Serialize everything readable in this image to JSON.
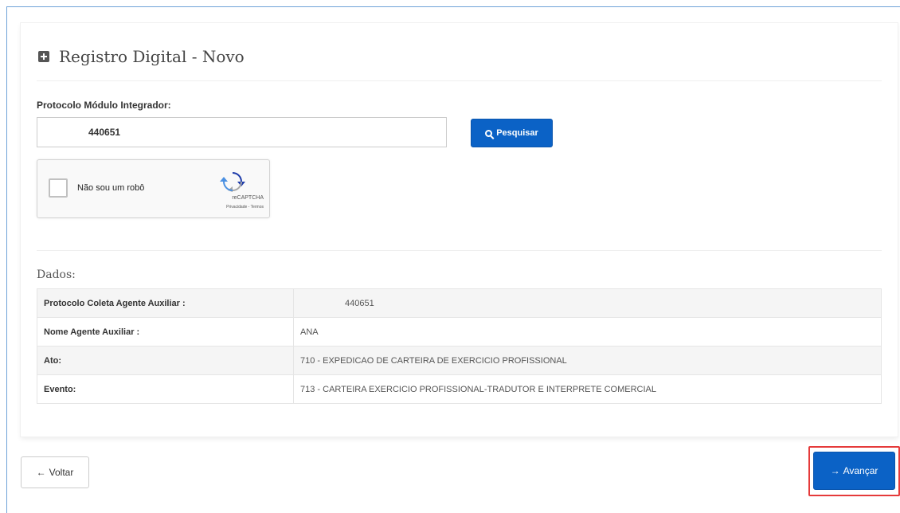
{
  "panel": {
    "title": "Registro Digital - Novo",
    "protocol_label": "Protocolo Módulo Integrador:",
    "protocol_value": "440651",
    "search_label": "Pesquisar"
  },
  "captcha": {
    "label": "Não sou um robô",
    "brand": "reCAPTCHA",
    "links": "Privacidade - Termos"
  },
  "data_section": {
    "heading": "Dados:",
    "rows": [
      {
        "key": "Protocolo Coleta Agente Auxiliar :",
        "value": "440651"
      },
      {
        "key": "Nome Agente Auxiliar :",
        "value": "ANA"
      },
      {
        "key": "Ato:",
        "value": "710 - EXPEDICAO DE CARTEIRA DE EXERCICIO PROFISSIONAL"
      },
      {
        "key": "Evento:",
        "value": "713 - CARTEIRA EXERCICIO PROFISSIONAL-TRADUTOR E INTERPRETE COMERCIAL"
      }
    ]
  },
  "footer": {
    "back_label": "Voltar",
    "next_label": "Avançar"
  },
  "icons": {
    "title": "plus-square-icon",
    "search": "search-icon",
    "back": "arrow-left-icon",
    "next": "arrow-right-icon",
    "captcha": "recaptcha-logo-icon"
  },
  "colors": {
    "primary": "#0b62c6",
    "highlight": "#e53a3a"
  }
}
